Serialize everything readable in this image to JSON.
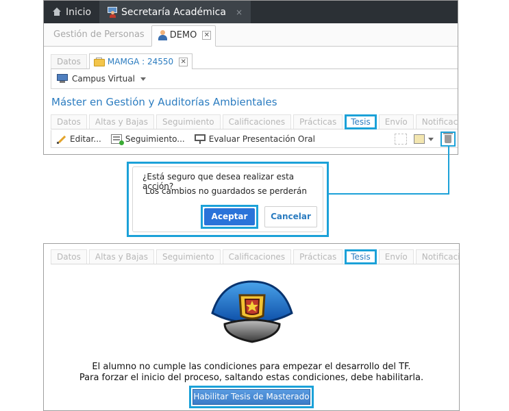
{
  "topbar": {
    "home_label": "Inicio",
    "section_label": "Secretaría Académica",
    "close_glyph": "×"
  },
  "people_tabs": {
    "inactive": "Gestión de Personas",
    "active": "DEMO",
    "close_glyph": "✕"
  },
  "record_tabs": {
    "inactive": "Datos",
    "active": "MAMGA : 24550",
    "close_glyph": "✕"
  },
  "campus_menu_label": "Campus Virtual",
  "program_title": "Máster en Gestión y Auditorías Ambientales",
  "detail_tabs": [
    "Datos",
    "Altas y Bajas",
    "Seguimiento",
    "Calificaciones",
    "Prácticas",
    "Tesis",
    "Envío",
    "Notificaciones"
  ],
  "active_detail_tab": "Tesis",
  "toolbar": {
    "edit_label": "Editar...",
    "followup_label": "Seguimiento...",
    "evaluate_label": "Evaluar Presentación Oral"
  },
  "dialog": {
    "question": "¿Está seguro que desea realizar esta acción?",
    "warning": "Los cambios no guardados se perderán",
    "accept_label": "Aceptar",
    "cancel_label": "Cancelar"
  },
  "thesis_panel": {
    "message_line1": "El alumno no cumple las condiciones para empezar el desarrollo del TF.",
    "message_line2": "Para forzar el inicio del proceso, saltando estas condiciones, debe habilitarla.",
    "enable_button_label": "Habilitar Tesis de Masterado"
  },
  "colors": {
    "highlight": "#1ba1d8",
    "link_blue": "#2b7cc0",
    "primary_button": "#2a73d9",
    "topbar": "#2b3035"
  }
}
